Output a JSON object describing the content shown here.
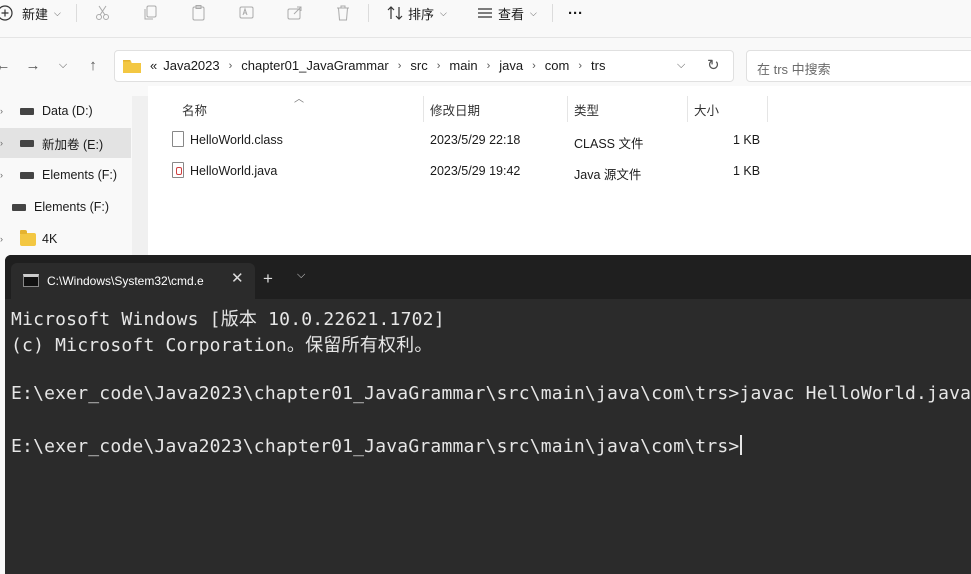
{
  "toolbar": {
    "new_label": "新建",
    "sort_label": "排序",
    "view_label": "查看",
    "more_label": "···"
  },
  "address": {
    "breadcrumbs": [
      "Java2023",
      "chapter01_JavaGrammar",
      "src",
      "main",
      "java",
      "com",
      "trs"
    ],
    "overflow": "«"
  },
  "search": {
    "placeholder": "在 trs 中搜索"
  },
  "sidebar": {
    "items": [
      {
        "label": "Data (D:)"
      },
      {
        "label": "新加卷 (E:)"
      },
      {
        "label": "Elements (F:)"
      },
      {
        "label": "Elements (F:)"
      },
      {
        "label": "4K"
      }
    ]
  },
  "columns": {
    "name": "名称",
    "modified": "修改日期",
    "type": "类型",
    "size": "大小"
  },
  "files": [
    {
      "name": "HelloWorld.class",
      "modified": "2023/5/29 22:18",
      "type": "CLASS 文件",
      "size": "1 KB"
    },
    {
      "name": "HelloWorld.java",
      "modified": "2023/5/29 19:42",
      "type": "Java 源文件",
      "size": "1 KB"
    }
  ],
  "terminal": {
    "tab_title": "C:\\Windows\\System32\\cmd.e",
    "lines": [
      "Microsoft Windows [版本 10.0.22621.1702]",
      "(c) Microsoft Corporation。保留所有权利。",
      "",
      "E:\\exer_code\\Java2023\\chapter01_JavaGrammar\\src\\main\\java\\com\\trs>javac HelloWorld.java",
      "",
      "E:\\exer_code\\Java2023\\chapter01_JavaGrammar\\src\\main\\java\\com\\trs>"
    ]
  }
}
